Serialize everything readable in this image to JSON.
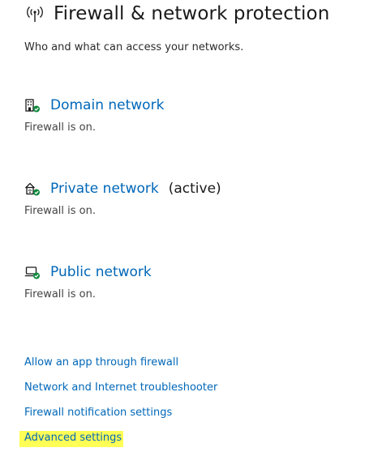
{
  "header": {
    "title": "Firewall & network protection",
    "subtitle": "Who and what can access your networks.",
    "icon": "wireless-antenna-icon"
  },
  "networks": [
    {
      "label": "Domain network",
      "active_label": "",
      "status": "Firewall is on.",
      "icon": "domain-building-icon"
    },
    {
      "label": "Private network",
      "active_label": "(active)",
      "status": "Firewall is on.",
      "icon": "private-home-network-icon"
    },
    {
      "label": "Public network",
      "active_label": "",
      "status": "Firewall is on.",
      "icon": "public-laptop-network-icon"
    }
  ],
  "links": [
    {
      "label": "Allow an app through firewall"
    },
    {
      "label": "Network and Internet troubleshooter"
    },
    {
      "label": "Firewall notification settings"
    },
    {
      "label": "Advanced settings",
      "highlighted": true
    }
  ],
  "colors": {
    "link": "#0067b8",
    "check_badge": "#10893e",
    "highlight": "#ffff55"
  }
}
